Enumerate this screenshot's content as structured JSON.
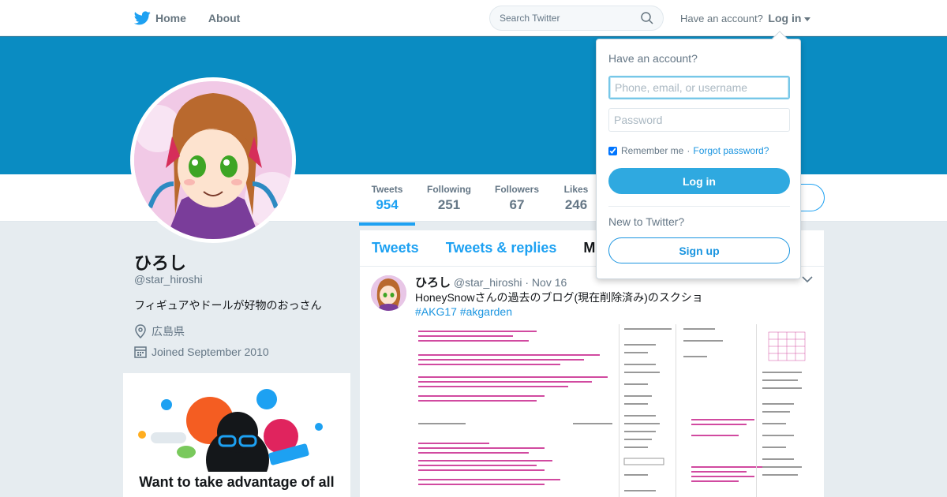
{
  "nav": {
    "home_label": "Home",
    "about_label": "About",
    "search_placeholder": "Search Twitter",
    "have_account": "Have an account?",
    "login_label": "Log in"
  },
  "profile": {
    "name": "ひろし",
    "handle": "@star_hiroshi",
    "bio": "フィギュアやドールが好物のおっさん",
    "location": "広島県",
    "joined": "Joined September 2010"
  },
  "stats": [
    {
      "label": "Tweets",
      "value": "954"
    },
    {
      "label": "Following",
      "value": "251"
    },
    {
      "label": "Followers",
      "value": "67"
    },
    {
      "label": "Likes",
      "value": "246"
    }
  ],
  "tabs": [
    "Tweets",
    "Tweets & replies",
    "M"
  ],
  "tweet": {
    "name": "ひろし",
    "handle": "@star_hiroshi",
    "date": "· Nov 16",
    "text": "HoneySnowさんの過去のブログ(現在削除済み)のスクショ",
    "hashtags": "#AKG17 #akgarden"
  },
  "promo": {
    "title": "Want to take advantage of all"
  },
  "login_panel": {
    "title": "Have an account?",
    "username_placeholder": "Phone, email, or username",
    "password_placeholder": "Password",
    "remember": "Remember me",
    "forgot": "Forgot password?",
    "login_button": "Log in",
    "new_to": "New to Twitter?",
    "signup_button": "Sign up"
  },
  "colors": {
    "brand": "#1da1f2",
    "banner": "#0a8cc2",
    "login_button": "#2fa9e0"
  },
  "icons": [
    "twitter-bird-icon",
    "search-icon",
    "location-icon",
    "calendar-icon",
    "chevron-down-icon"
  ]
}
